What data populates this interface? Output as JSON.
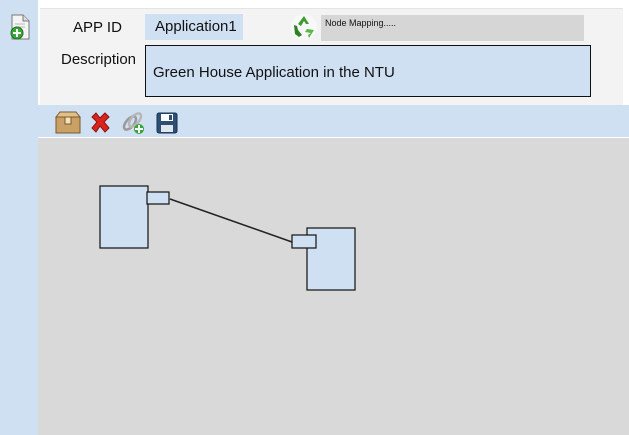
{
  "header": {
    "app_id_label": "APP ID",
    "app_id_value": "Application1",
    "description_label": "Description",
    "description_value": "Green House Application in the NTU",
    "progress_text": "Node Mapping....."
  },
  "icons": {
    "add_application": "add-document-icon",
    "status": "recycle-icon",
    "toolbar": [
      "package-icon",
      "delete-icon",
      "link-add-icon",
      "save-icon"
    ]
  },
  "canvas": {
    "nodes": 2,
    "connections": 1
  },
  "colors": {
    "panel_blue": "#cfe0f3",
    "canvas_gray": "#d9d9d9",
    "delete_red": "#d9231c"
  }
}
